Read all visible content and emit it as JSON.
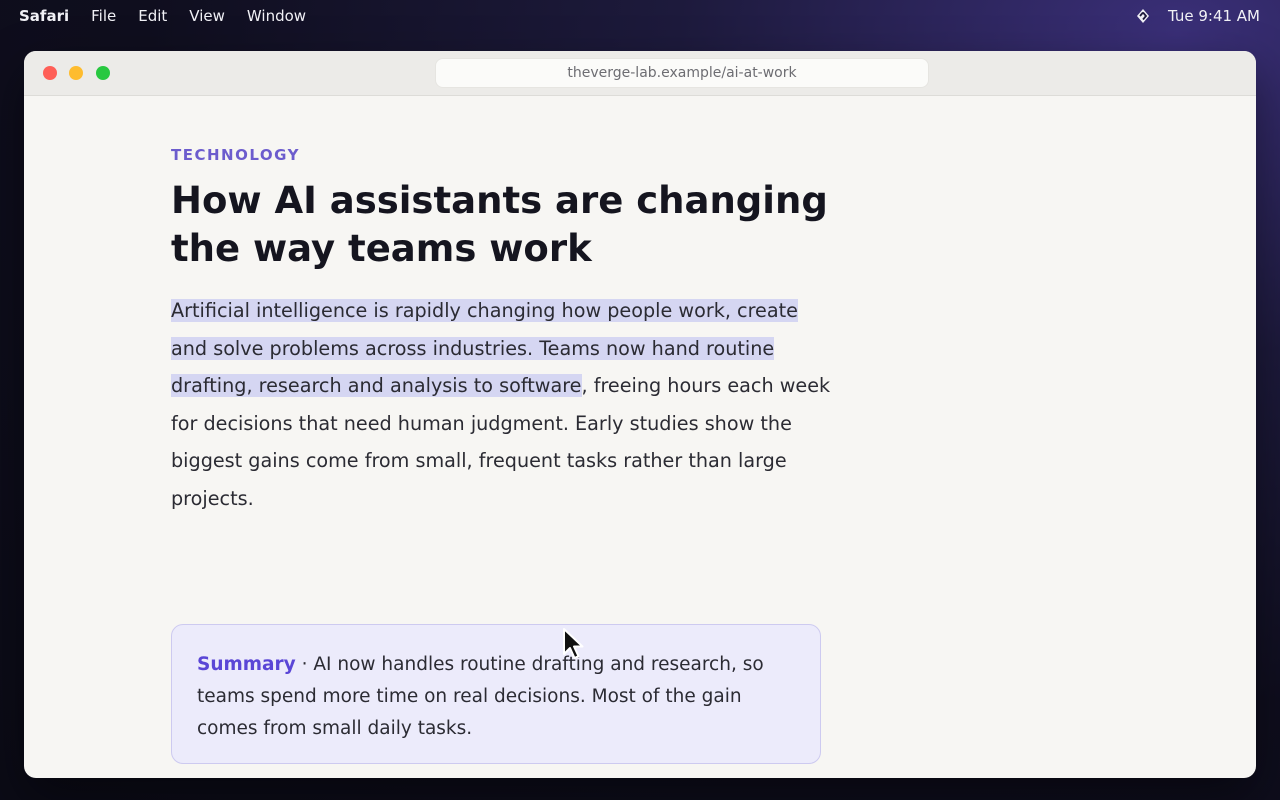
{
  "menubar": {
    "app": "Safari",
    "items": [
      "File",
      "Edit",
      "View",
      "Window"
    ],
    "clock": "Tue 9:41 AM",
    "status_icon": "sync-icon"
  },
  "browser": {
    "url": "theverge-lab.example/ai-at-work",
    "traffic_lights": [
      "close",
      "minimize",
      "zoom"
    ]
  },
  "article": {
    "kicker": "TECHNOLOGY",
    "headline": "How AI assistants are changing the way teams work",
    "body_selected": "Artificial intelligence is rapidly changing how people work, create and solve problems across industries. Teams now hand routine drafting, research and analysis to software",
    "body_rest": ", freeing hours each week for decisions that need human judgment. Early studies show the biggest gains come from small, frequent tasks rather than large projects."
  },
  "summary": {
    "label": "Summary",
    "separator": " · ",
    "text": "AI now handles routine drafting and research, so teams spend more time on real decisions. Most of the gain comes from small daily tasks."
  },
  "colors": {
    "accent": "#6c5ccd",
    "summary_label": "#5a46d6",
    "selection": "#d5d6f2",
    "summary_bg": "#ecebfb",
    "page_bg": "#f7f6f3"
  }
}
